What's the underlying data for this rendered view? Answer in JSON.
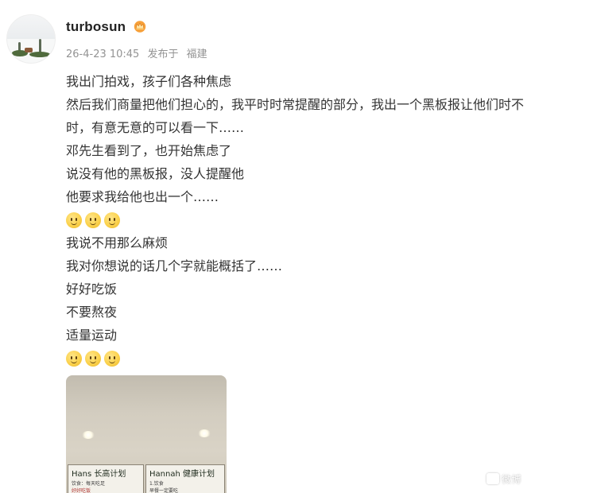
{
  "post": {
    "username": "turbosun",
    "vip_icon": "crown-badge-icon",
    "time": "26-4-23 10:45",
    "published_label": "发布于",
    "location": "福建",
    "lines": [
      "我出门拍戏，孩子们各种焦虑",
      "然后我们商量把他们担心的，我平时时常提醒的部分，我出一个黑板报让他们时不",
      "时，有意无意的可以看一下……",
      "邓先生看到了，也开始焦虑了",
      "说没有他的黑板报，没人提醒他",
      "他要求我给他也出一个……",
      "",
      "我说不用那么麻烦",
      "我对你想说的话几个字就能概括了……",
      "好好吃饭",
      "不要熬夜",
      "适量运动",
      ""
    ],
    "emoji_name": "smile-emoji-icon",
    "image": {
      "board_left_title": "Hans 长高计划",
      "board_right_title": "Hannah 健康计划",
      "board_left_text": "饮食：每天吃足",
      "board_left_text2": "好好吃饭",
      "board_right_text": "1.饮食",
      "board_right_text2": "早餐一定要吃"
    },
    "watermark": "微博"
  }
}
